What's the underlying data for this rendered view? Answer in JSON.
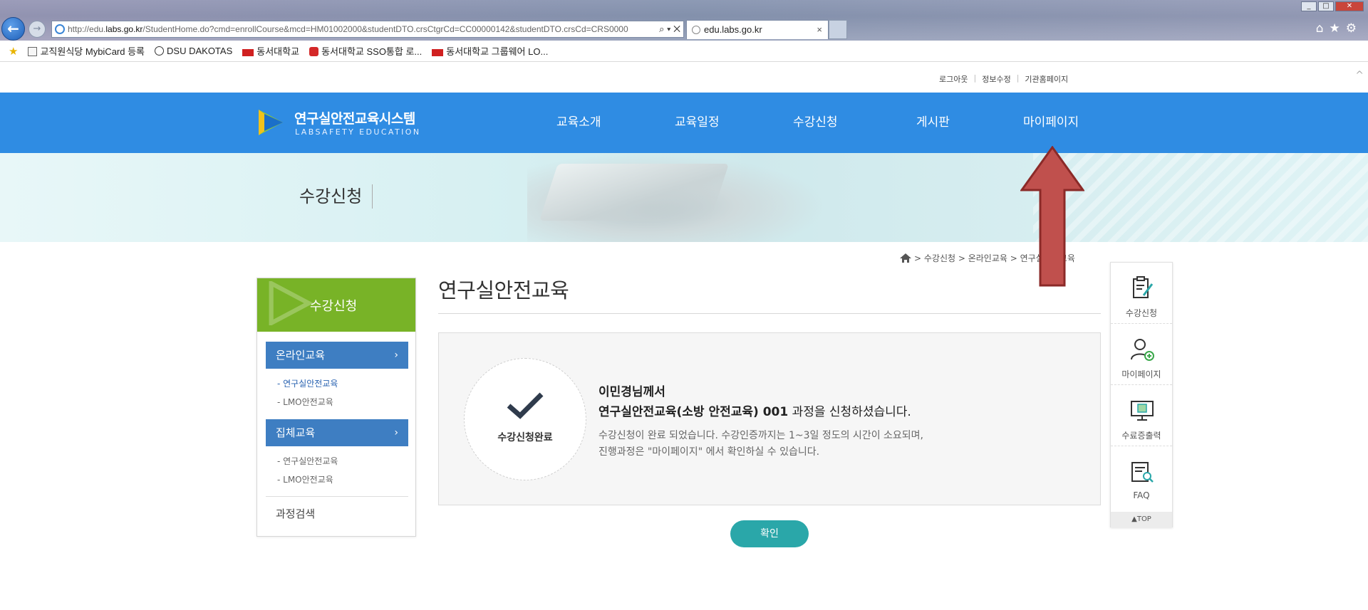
{
  "browser": {
    "url_prefix": "http://edu.",
    "url_domain": "labs.go.kr",
    "url_rest": "/StudentHome.do?cmd=enrollCourse&mcd=HM01002000&studentDTO.crsCtgrCd=CC00000142&studentDTO.crsCd=CRS0000",
    "tab_title": "edu.labs.go.kr",
    "tab_close": "×",
    "addr_controls": "⌕ ▾ ✕",
    "favorites": [
      {
        "label": "교직원식당 MybiCard 등록",
        "icon": "page-icon"
      },
      {
        "label": "DSU DAKOTAS",
        "icon": "circle-logo-icon"
      },
      {
        "label": "동서대학교",
        "icon": "dsu-logo-icon"
      },
      {
        "label": "동서대학교 SSO통합 로...",
        "icon": "red-logo-icon"
      },
      {
        "label": "동서대학교 그룹웨어 LO...",
        "icon": "dsu-logo-icon"
      }
    ]
  },
  "util_links": {
    "logout": "로그아웃",
    "edit_info": "정보수정",
    "org_home": "기관홈페이지"
  },
  "logo": {
    "title": "연구실안전교육시스템",
    "subtitle": "LABSAFETY EDUCATION"
  },
  "gnb": [
    "교육소개",
    "교육일정",
    "수강신청",
    "게시판",
    "마이페이지"
  ],
  "visual": {
    "title": "수강신청"
  },
  "breadcrumb": {
    "path": "> 수강신청 > 온라인교육 > 연구실안전교육"
  },
  "lnb": {
    "title": "수강신청",
    "categories": [
      {
        "label": "온라인교육",
        "arrow": "›",
        "subs": [
          "- 연구실안전교육",
          "- LMO안전교육"
        ]
      },
      {
        "label": "집체교육",
        "arrow": "›",
        "subs": [
          "- 연구실안전교육",
          "- LMO안전교육"
        ]
      }
    ],
    "search": "과정검색"
  },
  "content": {
    "title": "연구실안전교육",
    "badge": "수강신청완료",
    "line1": "이민경님께서",
    "course_name": "연구실안전교육(소방 안전교육) 001",
    "line2_suffix": " 과정을 신청하셨습니다.",
    "note1": "수강신청이 완료 되었습니다. 수강인증까지는 1~3일 정도의 시간이 소요되며,",
    "note2": "진행과정은 \"마이페이지\" 에서 확인하실 수 있습니다.",
    "confirm": "확인"
  },
  "quick_menu": {
    "items": [
      {
        "label": "수강신청",
        "icon": "clipboard-pen-icon"
      },
      {
        "label": "마이페이지",
        "icon": "user-plus-icon"
      },
      {
        "label": "수료증출력",
        "icon": "monitor-certificate-icon"
      },
      {
        "label": "FAQ",
        "icon": "notepad-search-icon"
      }
    ],
    "top": "▲TOP"
  },
  "colors": {
    "gnb": "#2f8ce3",
    "lnb_head": "#78b327",
    "lnb_cat": "#3e7ec2",
    "confirm": "#2aa7a9",
    "annotation_arrow": "#c0392b"
  }
}
